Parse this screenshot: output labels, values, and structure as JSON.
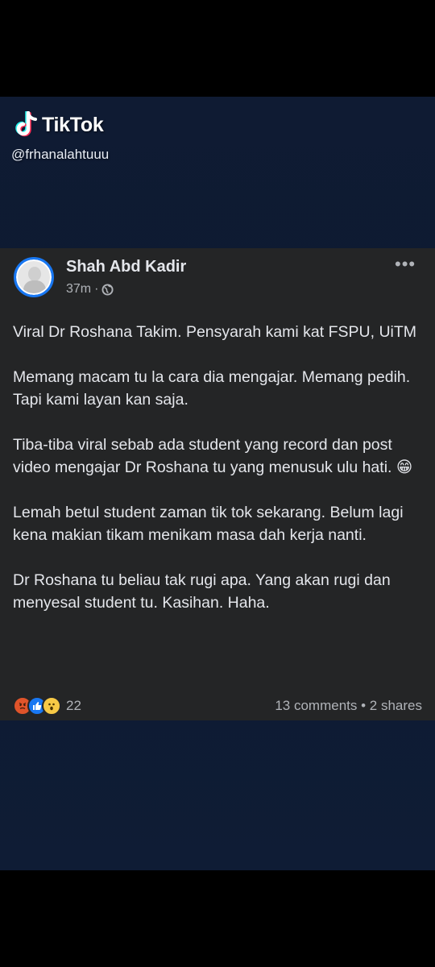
{
  "tiktok": {
    "brand": "TikTok",
    "handle": "@frhanalahtuuu"
  },
  "post": {
    "author": "Shah Abd Kadir",
    "time": "37m",
    "separator": "·",
    "privacy_icon": "globe-icon",
    "more_icon": "more-options-icon",
    "paragraphs": [
      "Viral Dr Roshana Takim. Pensyarah kami kat FSPU, UiTM",
      "Memang macam tu la cara dia mengajar. Memang pedih. Tapi kami layan kan saja.",
      "Tiba-tiba viral sebab ada student yang record dan post video mengajar Dr Roshana tu yang menusuk ulu hati. 😁",
      "Lemah betul student zaman tik tok sekarang. Belum lagi kena makian tikam menikam masa dah kerja nanti.",
      "Dr Roshana tu beliau tak rugi apa. Yang akan rugi dan menyesal student tu. Kasihan. Haha."
    ],
    "reactions": {
      "icons": [
        "angry-reaction-icon",
        "like-reaction-icon",
        "wow-reaction-icon"
      ],
      "count": "22"
    },
    "comments": "13 comments",
    "shares": "2 shares",
    "counts_separator": "•"
  },
  "colors": {
    "post_bg": "#242526",
    "video_bg": "#0f1b33",
    "text": "#e4e6eb",
    "muted": "#b0b3b8",
    "accent": "#1877f2"
  }
}
